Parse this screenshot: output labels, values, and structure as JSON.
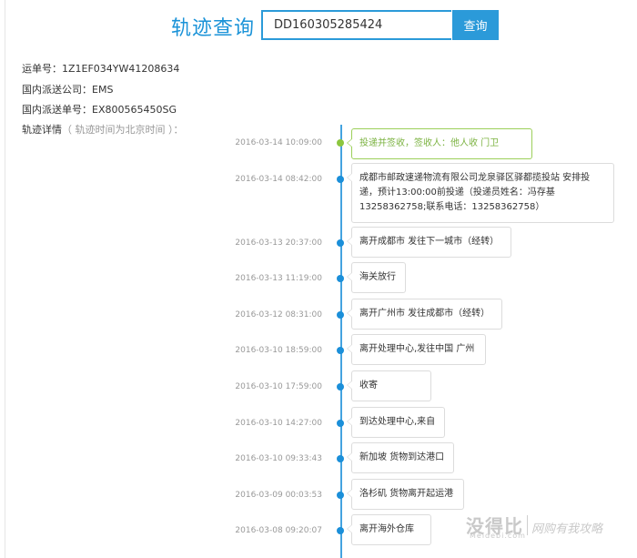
{
  "search": {
    "title": "轨迹查询",
    "value": "DD160305285424",
    "button": "查询"
  },
  "info": {
    "waybill_label": "运单号：",
    "waybill": "1Z1EF034YW41208634",
    "carrier_label": "国内派送公司：",
    "carrier": "EMS",
    "domestic_no_label": "国内派送单号：",
    "domestic_no": "EX800565450SG",
    "details_label": "轨迹详情",
    "details_note": "（ 轨迹时间为北京时间 ）："
  },
  "timeline": [
    {
      "time": "2016-03-14 10:09:00",
      "text": "投递并签收，签收人：他人收 门卫"
    },
    {
      "time": "2016-03-14 08:42:00",
      "text": "成都市邮政速递物流有限公司龙泉驿区驿都揽投站 安排投递，预计13:00:00前投递（投递员姓名：冯存基13258362758;联系电话：13258362758）"
    },
    {
      "time": "2016-03-13 20:37:00",
      "text": "离开成都市 发往下一城市（经转）"
    },
    {
      "time": "2016-03-13 11:19:00",
      "text": "海关放行"
    },
    {
      "time": "2016-03-12 08:31:00",
      "text": "离开广州市 发往成都市（经转）"
    },
    {
      "time": "2016-03-10 18:59:00",
      "text": "离开处理中心,发往中国 广州"
    },
    {
      "time": "2016-03-10 17:59:00",
      "text": "收寄"
    },
    {
      "time": "2016-03-10 14:27:00",
      "text": "到达处理中心,来自"
    },
    {
      "time": "2016-03-10 09:33:43",
      "text": "新加坡 货物到达港口"
    },
    {
      "time": "2016-03-09 00:03:53",
      "text": "洛杉矶 货物离开起运港"
    },
    {
      "time": "2016-03-08 09:20:07",
      "text": "离开海外仓库"
    }
  ],
  "watermark": {
    "brand": "没得比",
    "slogan": "网购有我攻略",
    "url": "Meidebi.com"
  },
  "colors": {
    "accent": "#2b9ad9",
    "signed": "#8cc63f"
  }
}
